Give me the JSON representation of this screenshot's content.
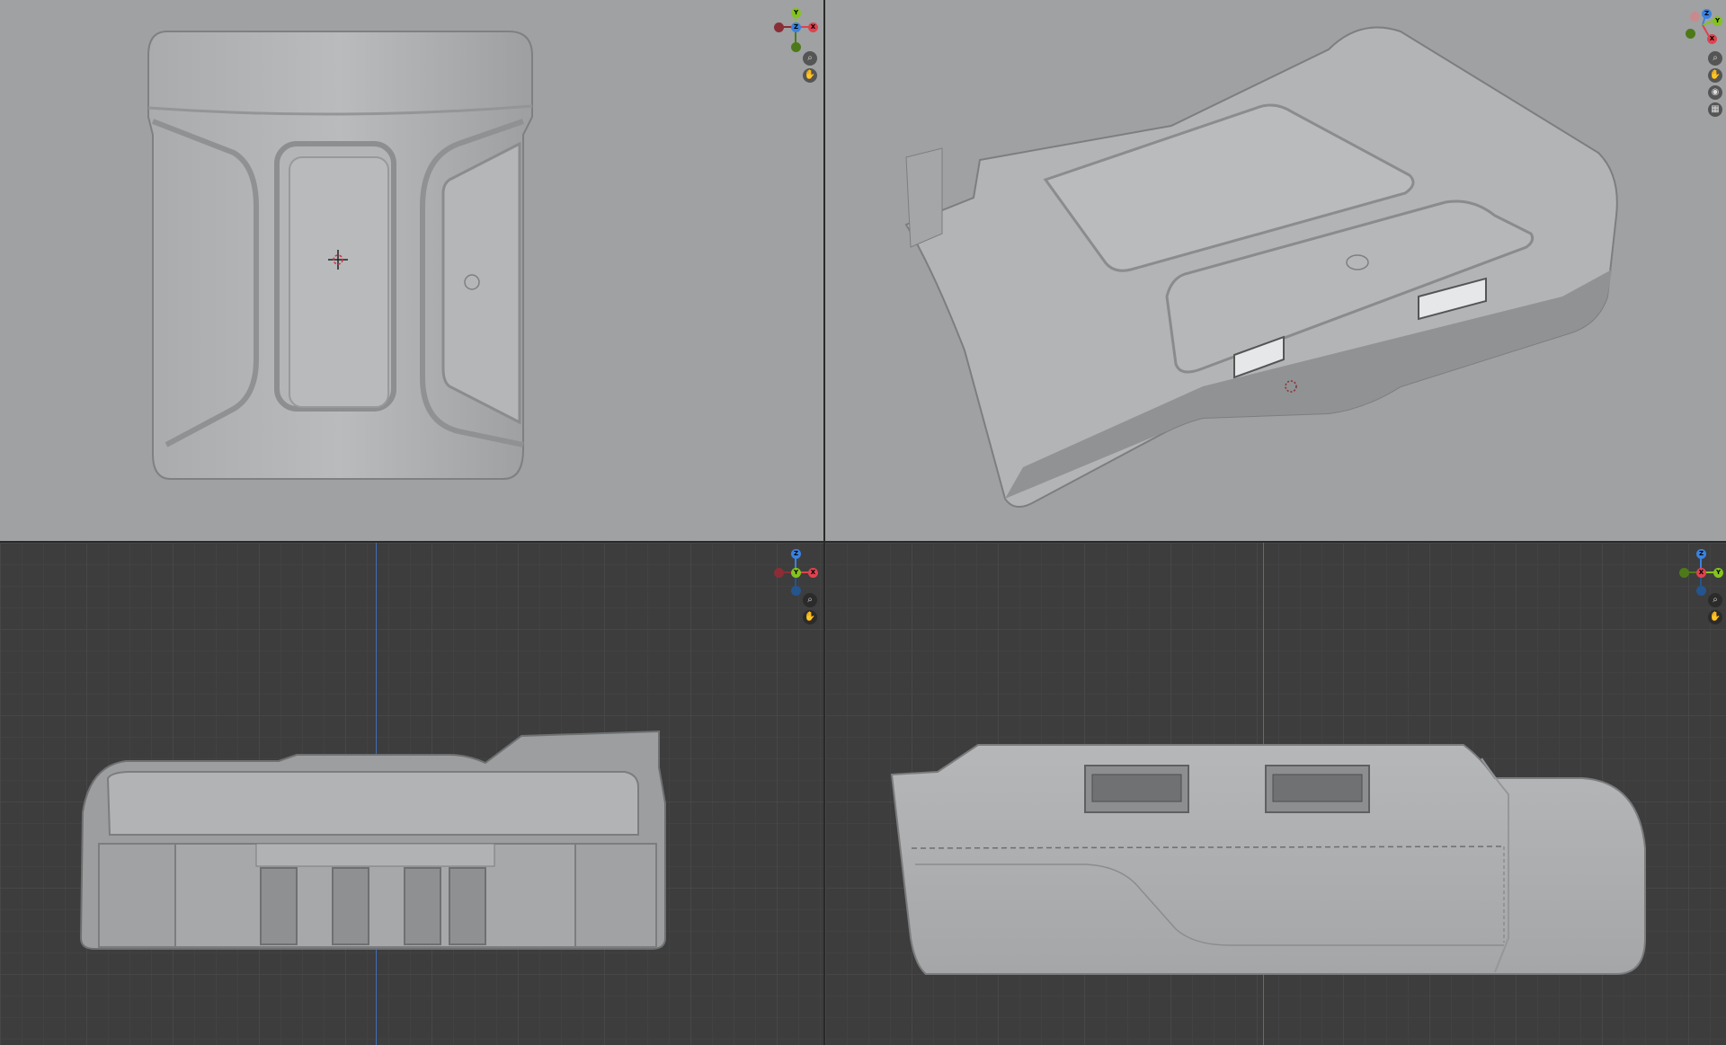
{
  "viewports": [
    {
      "id": "top",
      "view": "top-orthographic",
      "shading": "solid"
    },
    {
      "id": "perspective",
      "view": "user-perspective",
      "shading": "solid"
    },
    {
      "id": "front",
      "view": "front-orthographic",
      "shading": "solid",
      "grid": true
    },
    {
      "id": "side",
      "view": "right-orthographic",
      "shading": "solid",
      "grid": true
    }
  ],
  "gizmo": {
    "axis_labels": {
      "x": "X",
      "y": "Y",
      "z": "Z"
    },
    "colors": {
      "x": "#e0424f",
      "y": "#84c31f",
      "z": "#3a82e0",
      "x_neg": "#8a2e36",
      "y_neg": "#4d7a18",
      "z_neg": "#24558f"
    }
  },
  "nav_icons": [
    "zoom-icon",
    "hand-pan-icon",
    "camera-icon",
    "grid-toggle-icon"
  ],
  "colors": {
    "solid_background": "#9fa1a3",
    "grid_background": "#3d3d3d",
    "model_fill": "#b6b8ba",
    "model_shadow": "#8e9092",
    "z_axis_line": "#3f6fb8"
  }
}
